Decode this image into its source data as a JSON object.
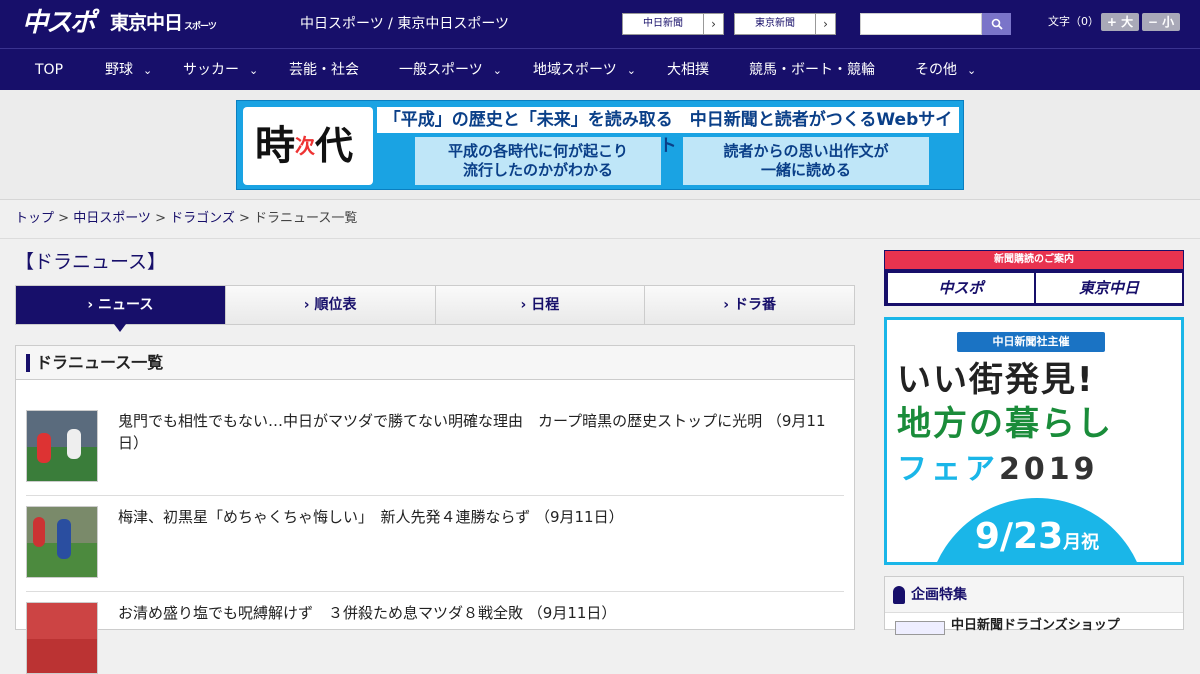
{
  "header": {
    "logo_main": "中スポ",
    "logo_sub": "東京中日",
    "logo_sub_small": "スポーツ",
    "site_title": "中日スポーツ / 東京中日スポーツ",
    "paper_links": [
      "中日新聞",
      "東京新聞"
    ],
    "search_icon": "search-icon",
    "font_size_label": "文字（0）",
    "font_plus": "+ 大",
    "font_minus": "− 小"
  },
  "nav": {
    "items": [
      "TOP",
      "野球",
      "サッカー",
      "芸能・社会",
      "一般スポーツ",
      "地域スポーツ",
      "大相撲",
      "競馬・ボート・競輪",
      "その他"
    ],
    "chevron": "⌄"
  },
  "banner": {
    "kanji_ji": "時",
    "kanji_tsugi": "次",
    "kanji_dai": "代",
    "headline": "「平成」の歴史と「未来」を読み取る　中日新聞と読者がつくるWebサイト",
    "box1_line1": "平成の各時代に何が起こり",
    "box1_line2": "流行したのかがわかる",
    "box2_line1": "読者からの思い出作文が",
    "box2_line2": "一緒に読める"
  },
  "breadcrumb": {
    "top": "トップ",
    "sep": " > ",
    "chunichi": "中日スポーツ",
    "dragons": "ドラゴンズ",
    "current": "ドラニュース一覧"
  },
  "page": {
    "title": "【ドラニュース】"
  },
  "tabs": [
    "ニュース",
    "順位表",
    "日程",
    "ドラ番"
  ],
  "tab_prefix": "›",
  "list": {
    "heading": "ドラニュース一覧",
    "items": [
      "鬼門でも相性でもない…中日がマツダで勝てない明確な理由　カープ暗黒の歴史ストップに光明 （9月11日）",
      "梅津、初黒星「めちゃくちゃ悔しい」　新人先発４連勝ならず （9月11日）",
      "お清め盛り塩でも呪縛解けず　３併殺ため息マツダ８戦全敗 （9月11日）"
    ]
  },
  "sidebar": {
    "subscribe_label": "新聞購読のご案内",
    "subscribe_a": "中スポ",
    "subscribe_b": "東京中日",
    "ad_tag": "中日新聞社主催",
    "ad_line1": "いい街発見!",
    "ad_line2": "地方の暮らし",
    "ad_line3a": "フェア",
    "ad_line3b": "2019",
    "ad_date": "9/23",
    "ad_date_suffix": "月祝",
    "feature_heading": "企画特集",
    "feature_item": "中日新聞ドラゴンズショップ"
  },
  "colors": {
    "brand_navy": "#170f6a",
    "banner_blue": "#1aa3e3",
    "ad_cyan": "#1ab6e8",
    "subscribe_red": "#e8334f"
  }
}
